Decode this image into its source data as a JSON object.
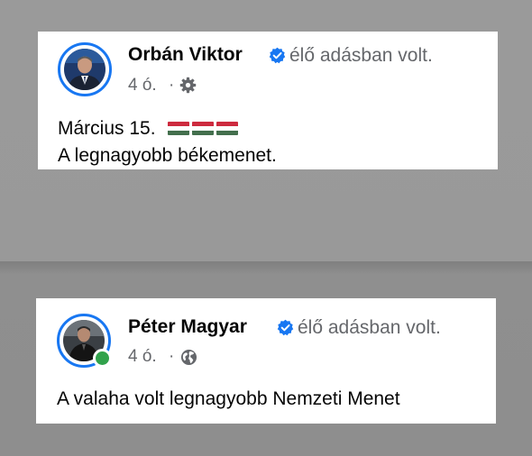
{
  "posts": [
    {
      "author": "Orbán Viktor",
      "action": "élő adásban volt.",
      "time": "4 ó.",
      "separator": "·",
      "audience_icon": "gear-icon",
      "verified_icon": "verified-badge-icon",
      "text_lines": [
        "Március 15.",
        "A legnagyobb békemenet."
      ],
      "flag_icon": "hungary-flag-icon",
      "flag_count": 3
    },
    {
      "author": "Péter Magyar",
      "action": "élő adásban volt.",
      "time": "4 ó.",
      "separator": "·",
      "audience_icon": "globe-icon",
      "verified_icon": "verified-badge-icon",
      "online": true,
      "text_lines": [
        "A valaha volt legnagyobb Nemzeti Menet"
      ]
    }
  ],
  "colors": {
    "verified_blue": "#1877f2",
    "meta_gray": "#65676b",
    "online_green": "#31a24c"
  }
}
